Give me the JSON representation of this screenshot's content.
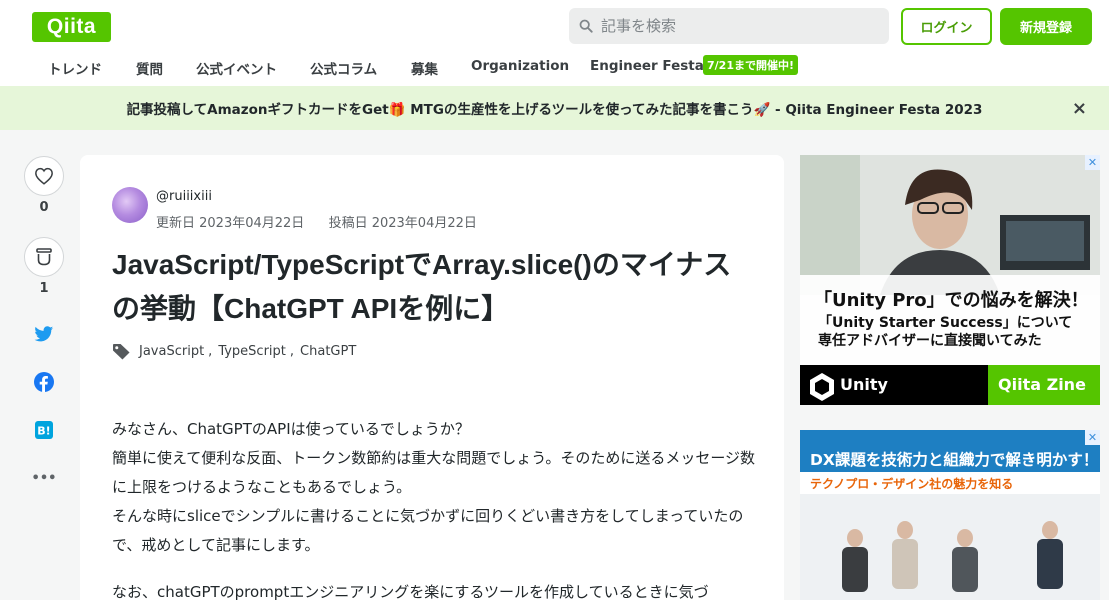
{
  "header": {
    "logo": "Qiita",
    "search_placeholder": "記事を検索",
    "login_label": "ログイン",
    "signup_label": "新規登録"
  },
  "nav": {
    "items": [
      "トレンド",
      "質問",
      "公式イベント",
      "公式コラム",
      "募集",
      "Organization",
      "Engineer Festa"
    ],
    "badge": "7/21まで開催中!"
  },
  "banner": {
    "text": "記事投稿してAmazonギフトカードをGet🎁 MTGの生産性を上げるツールを使ってみた記事を書こう🚀 - Qiita Engineer Festa 2023",
    "close": "×"
  },
  "sidebar": {
    "like_count": "0",
    "stock_count": "1",
    "more": "•••"
  },
  "article": {
    "author": "@ruiiixiii",
    "updated": "更新日 2023年04月22日",
    "posted": "投稿日 2023年04月22日",
    "title": "JavaScript/TypeScriptでArray.slice()のマイナスの挙動【ChatGPT APIを例に】",
    "tags": [
      "JavaScript",
      "TypeScript",
      "ChatGPT"
    ],
    "paragraphs": [
      "みなさん、ChatGPTのAPIは使っているでしょうか？",
      "簡単に使えて便利な反面、トークン数節約は重大な問題でしょう。そのために送るメッセージ数に上限をつけるようなこともあるでしょう。",
      "そんな時にsliceでシンプルに書けることに気づかずに回りくどい書き方をしてしまっていたので、戒めとして記事にします。",
      "なお、chatGPTのpromptエンジニアリングを楽にするツールを作成しているときに気づ"
    ]
  },
  "ads": {
    "ad1_headline": "「Unity Pro」での悩みを解決！",
    "ad1_sub1": "「Unity Starter Success」について",
    "ad1_sub2": "専任アドバイザーに直接聞いてみた",
    "ad1_brand_left": "Unity",
    "ad1_brand_right": "Qiita Zine",
    "ad2_headline": "DX課題を技術力と組織力で解き明かす！",
    "ad2_sub": "テクノプロ・デザイン社の魅力を知る"
  },
  "colors": {
    "brand": "#55c500",
    "banner_bg": "#e6f6d9"
  }
}
